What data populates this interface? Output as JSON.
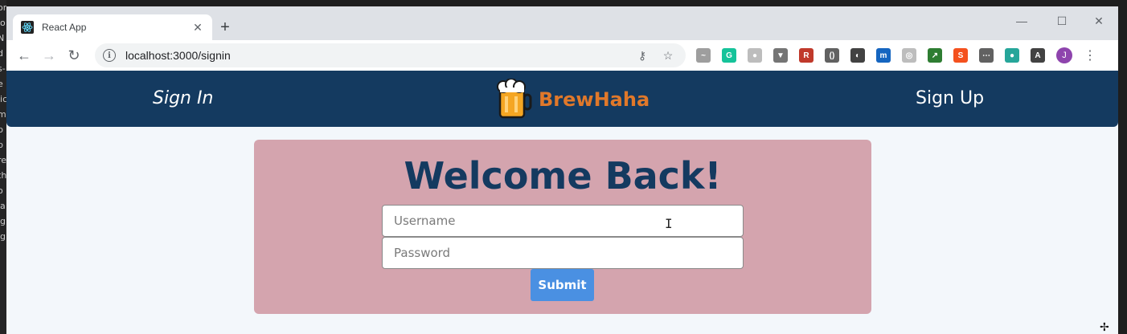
{
  "editor_edge": [
    "or",
    "io",
    "N",
    "d",
    "s-",
    "",
    "e",
    "lic",
    "",
    "m",
    "p",
    "p",
    "re",
    "th",
    "o",
    "la",
    "ig",
    "ig"
  ],
  "browser": {
    "tab": {
      "title": "React App",
      "favicon": "react-icon",
      "close_glyph": "✕"
    },
    "new_tab_glyph": "+",
    "window_controls": {
      "minimize": "—",
      "maximize": "☐",
      "close": "✕"
    },
    "nav": {
      "back": "←",
      "forward": "→",
      "reload": "↻"
    },
    "url": "localhost:3000/signin",
    "profile_initial": "J",
    "extensions": [
      {
        "name": "ext-1-icon",
        "color": "#9e9e9e",
        "glyph": "~"
      },
      {
        "name": "grammarly-icon",
        "color": "#15c39a",
        "glyph": "G"
      },
      {
        "name": "ext-3-icon",
        "color": "#bdbdbd",
        "glyph": "●"
      },
      {
        "name": "vue-devtools-icon",
        "color": "#757575",
        "glyph": "▼"
      },
      {
        "name": "ext-5-icon",
        "color": "#c0392b",
        "glyph": "R"
      },
      {
        "name": "ext-6-icon",
        "color": "#616161",
        "glyph": "()"
      },
      {
        "name": "ext-7-icon",
        "color": "#424242",
        "glyph": "◐"
      },
      {
        "name": "ext-8-icon",
        "color": "#1565c0",
        "glyph": "m"
      },
      {
        "name": "ext-9-icon",
        "color": "#bdbdbd",
        "glyph": "◎"
      },
      {
        "name": "ext-10-icon",
        "color": "#2e7d32",
        "glyph": "↗"
      },
      {
        "name": "ext-11-icon",
        "color": "#f4511e",
        "glyph": "S"
      },
      {
        "name": "ext-12-icon",
        "color": "#616161",
        "glyph": "⋯"
      },
      {
        "name": "ext-13-icon",
        "color": "#26a69a",
        "glyph": "●"
      },
      {
        "name": "ext-14-icon",
        "color": "#424242",
        "glyph": "A"
      }
    ]
  },
  "app": {
    "nav": {
      "sign_in": "Sign In",
      "brand": "BrewHaha",
      "sign_up": "Sign Up"
    },
    "form": {
      "heading": "Welcome Back!",
      "username_placeholder": "Username",
      "password_placeholder": "Password",
      "submit": "Submit"
    }
  },
  "colors": {
    "navbar": "#143a60",
    "brand": "#e0782a",
    "card": "#d4a4ae",
    "submit": "#4a90e2"
  }
}
